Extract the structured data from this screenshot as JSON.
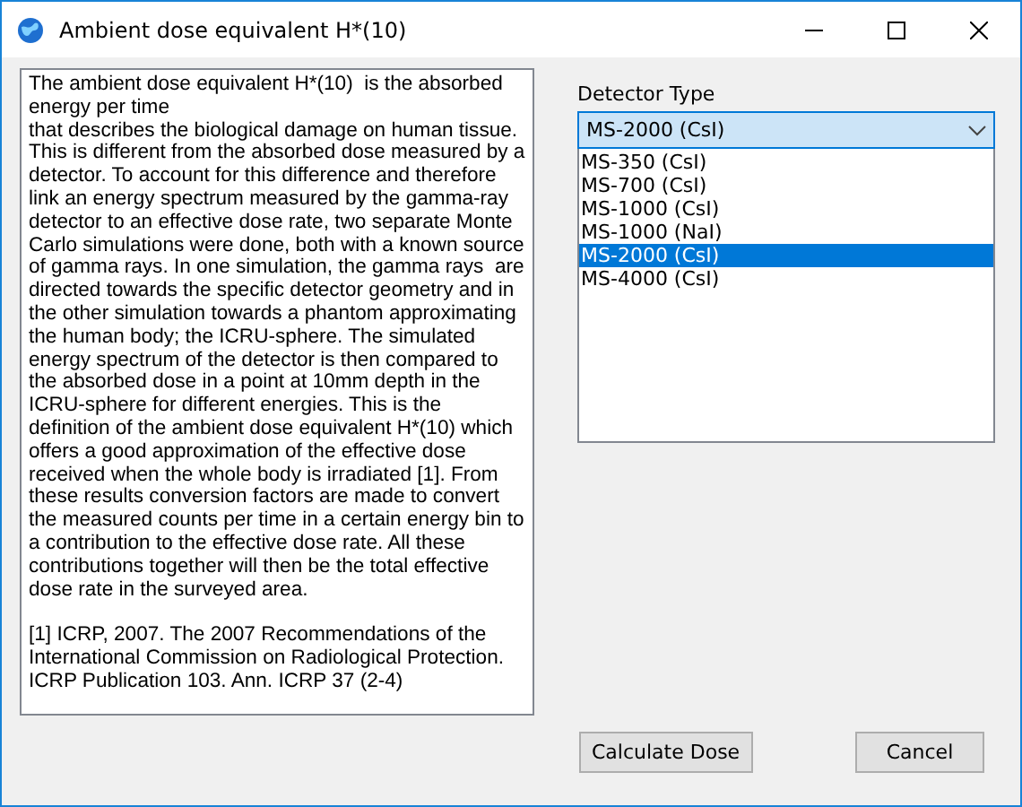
{
  "window": {
    "title": "Ambient dose equivalent H*(10)"
  },
  "description": {
    "paragraphs": [
      "The ambient dose equivalent H*(10)  is the absorbed energy per time",
      "that describes the biological damage on human tissue. This is different from the absorbed dose measured by a detector. To account for this difference and therefore link an energy spectrum measured by the gamma-ray detector to an effective dose rate, two separate Monte Carlo simulations were done, both with a known source of gamma rays. In one simulation, the gamma rays  are directed towards the specific detector geometry and in the other simulation towards a phantom approximating the human body; the ICRU-sphere. The simulated energy spectrum of the detector is then compared to the absorbed dose in a point at 10mm depth in the ICRU-sphere for different energies. This is the definition of the ambient dose equivalent H*(10) which offers a good approximation of the effective dose received when the whole body is irradiated [1]. From these results conversion factors are made to convert the measured counts per time in a certain energy bin to a contribution to the effective dose rate. All these contributions together will then be the total effective dose rate in the surveyed area.",
      "[1] ICRP, 2007. The 2007 Recommendations of the International Commission on Radiological Protection. ICRP Publication 103. Ann. ICRP 37 (2-4)"
    ]
  },
  "detector_type": {
    "label": "Detector Type",
    "value": "MS-2000 (CsI)",
    "expanded": true,
    "options": [
      {
        "label": "MS-350 (CsI)",
        "selected": false
      },
      {
        "label": "MS-700 (CsI)",
        "selected": false
      },
      {
        "label": "MS-1000 (CsI)",
        "selected": false
      },
      {
        "label": "MS-1000 (NaI)",
        "selected": false
      },
      {
        "label": "MS-2000 (CsI)",
        "selected": true
      },
      {
        "label": "MS-4000 (CsI)",
        "selected": false
      }
    ]
  },
  "buttons": [
    {
      "label": "Calculate Dose"
    },
    {
      "label": "Cancel"
    }
  ]
}
